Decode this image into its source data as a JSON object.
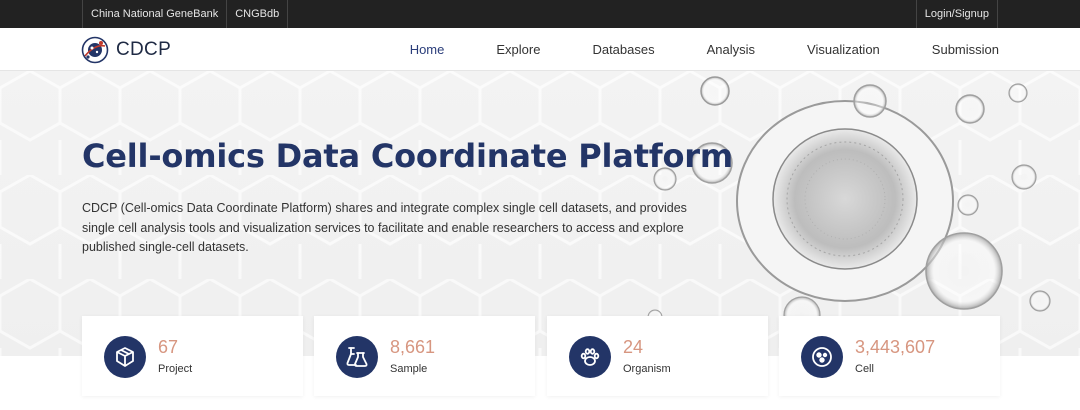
{
  "topbar": {
    "links": [
      "China National GeneBank",
      "CNGBdb"
    ],
    "login": "Login/Signup"
  },
  "header": {
    "logo_text": "CDCP",
    "menu": [
      "Home",
      "Explore",
      "Databases",
      "Analysis",
      "Visualization",
      "Submission"
    ],
    "active": "Home"
  },
  "hero": {
    "title": "Cell-omics Data Coordinate Platform",
    "description": "CDCP (Cell-omics Data Coordinate Platform) shares and integrate complex single cell datasets, and provides single cell analysis tools and visualization services to facilitate and enable researchers to access and explore published single-cell datasets."
  },
  "stats": [
    {
      "value": "67",
      "label": "Project",
      "icon": "box-icon"
    },
    {
      "value": "8,661",
      "label": "Sample",
      "icon": "flask-icon"
    },
    {
      "value": "24",
      "label": "Organism",
      "icon": "paw-icon"
    },
    {
      "value": "3,443,607",
      "label": "Cell",
      "icon": "cell-icon"
    }
  ],
  "colors": {
    "brand": "#233567",
    "stat_number": "#d79680",
    "topbar": "#222222"
  }
}
